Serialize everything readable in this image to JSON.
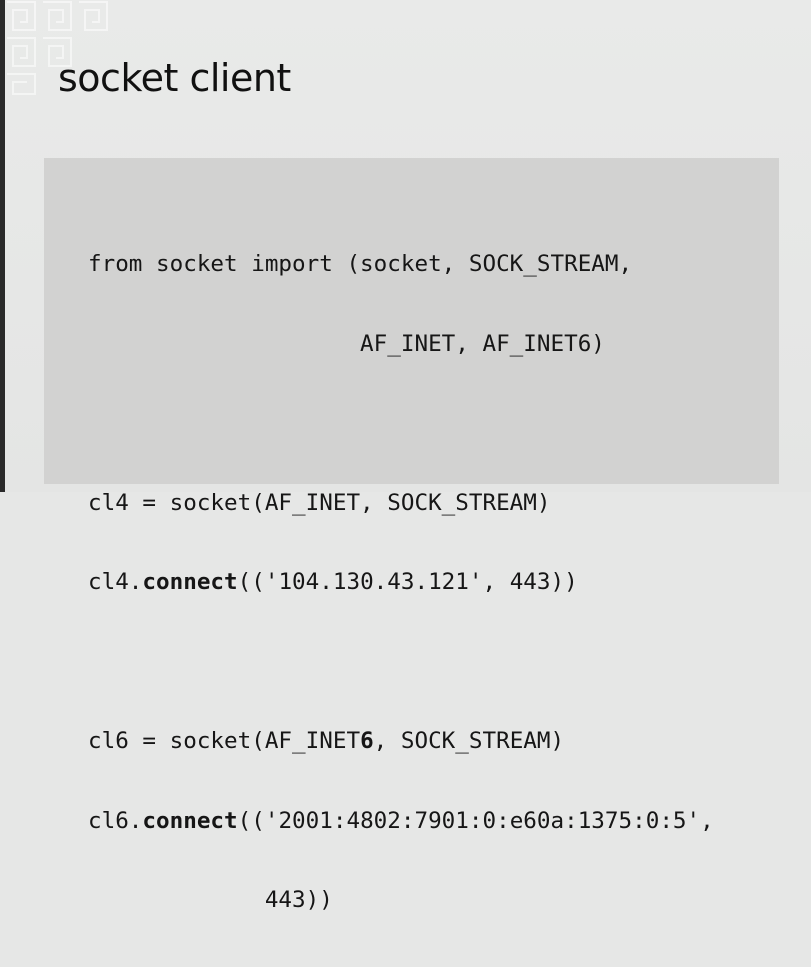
{
  "slide": {
    "title": "socket client"
  },
  "code": {
    "lines": [
      "from socket import (socket, SOCK_STREAM,",
      "                    AF_INET, AF_INET6)",
      "",
      "cl4 = socket(AF_INET, SOCK_STREAM)",
      "cl4.connect(('104.130.43.121', 443))",
      "",
      "cl6 = socket(AF_INET6, SOCK_STREAM)",
      "cl6.connect(('2001:4802:7901:0:e60a:1375:0:5',",
      "             443))"
    ],
    "segments": {
      "l1": "from socket import (socket, SOCK_STREAM,",
      "l2": "                    AF_INET, AF_INET6)",
      "l4": "cl4 = socket(AF_INET, SOCK_STREAM)",
      "l5_pre": "cl4.",
      "l5_bold": "connect",
      "l5_post": "(('104.130.43.121', 443))",
      "l7_pre": "cl6 = socket(AF_INET",
      "l7_bold": "6",
      "l7_post": ", SOCK_STREAM)",
      "l8_pre": "cl6.",
      "l8_bold": "connect",
      "l8_post": "(('2001:4802:7901:0:e60a:1375:0:5',",
      "l9": "             443))"
    }
  },
  "colors": {
    "background": "#e6e7e6",
    "code_background": "#d2d2d1",
    "text": "#111111"
  },
  "icons": {
    "corner": "greek-key-pattern"
  }
}
